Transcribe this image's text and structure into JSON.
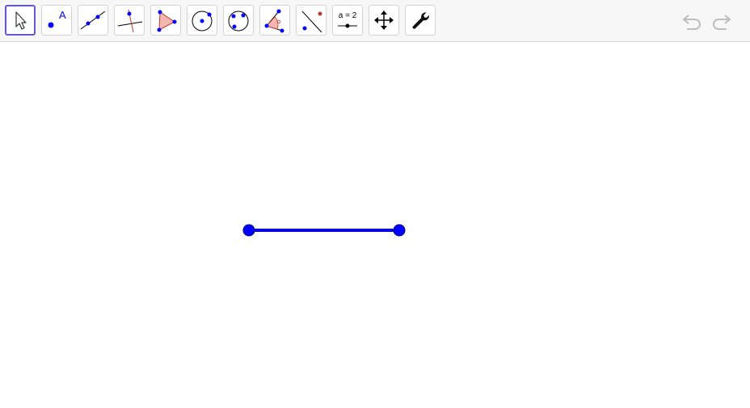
{
  "toolbar": {
    "tools": [
      {
        "name": "move-tool",
        "active": true
      },
      {
        "name": "point-tool",
        "glyph": "A"
      },
      {
        "name": "line-tool"
      },
      {
        "name": "perpendicular-line-tool"
      },
      {
        "name": "polygon-tool"
      },
      {
        "name": "circle-center-point-tool"
      },
      {
        "name": "circle-three-points-tool"
      },
      {
        "name": "angle-tool"
      },
      {
        "name": "reflect-about-line-tool"
      },
      {
        "name": "slider-tool",
        "label": "a = 2"
      },
      {
        "name": "move-graphics-view-tool"
      },
      {
        "name": "settings-tool"
      }
    ],
    "undo_icon": "undo-icon",
    "redo_icon": "redo-icon"
  },
  "canvas": {
    "segment_color": "#0000ff",
    "point_color": "#0000ff"
  },
  "colors": {
    "accent": "#6557d2",
    "toolbar_bg": "#f7f7f7",
    "point_blue": "#0000ff",
    "angle_red": "#d64541"
  }
}
